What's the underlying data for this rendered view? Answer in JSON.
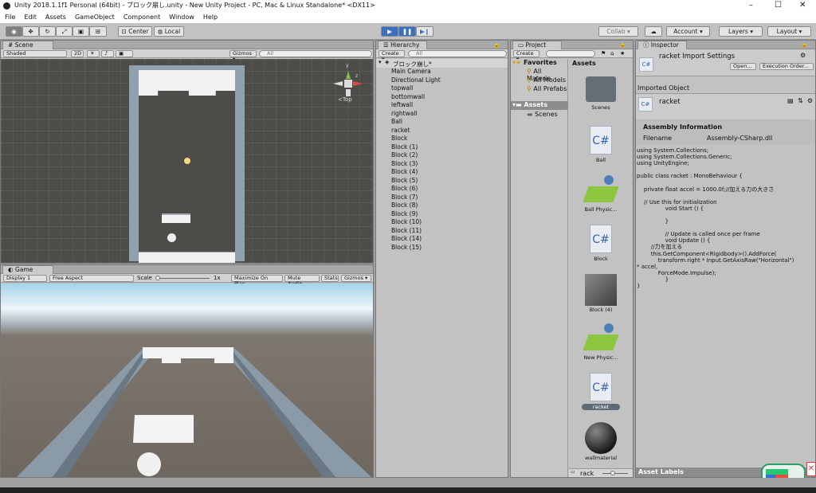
{
  "window": {
    "title": "Unity 2018.1.1f1 Personal (64bit) - ブロック崩し.unity - New Unity Project - PC, Mac & Linux Standalone* <DX11>",
    "minimize": "–",
    "maximize": "☐",
    "close": "✕"
  },
  "menu": [
    "File",
    "Edit",
    "Assets",
    "GameObject",
    "Component",
    "Window",
    "Help"
  ],
  "toolbar": {
    "center": "Center",
    "local": "Local",
    "collab": "Collab ▾",
    "account": "Account ▾",
    "layers": "Layers ▾",
    "layout": "Layout ▾"
  },
  "scene": {
    "tab": "Scene",
    "shading": "Shaded",
    "mode2d": "2D",
    "gizmos": "Gizmos ▾",
    "search_placeholder": "All",
    "gizmo_label": "Top",
    "axis_y": "y",
    "axis_z": "z"
  },
  "game": {
    "tab": "Game",
    "display": "Display 1",
    "aspect": "Free Aspect",
    "scale_label": "Scale",
    "scale_value": "1x",
    "maximize": "Maximize On Play",
    "mute": "Mute Audio",
    "stats": "Stats",
    "gizmos": "Gizmos ▾"
  },
  "hierarchy": {
    "tab": "Hierarchy",
    "create": "Create ▾",
    "search_placeholder": "All",
    "scene_name": "ブロック崩し*",
    "items": [
      "Main Camera",
      "Directional Light",
      "topwall",
      "bottomwall",
      "leftwall",
      "rightwall",
      "Ball",
      "racket",
      "Block",
      "Block (1)",
      "Block (2)",
      "Block (3)",
      "Block (4)",
      "Block (5)",
      "Block (6)",
      "Block (7)",
      "Block (8)",
      "Block (9)",
      "Block (10)",
      "Block (11)",
      "Block (14)",
      "Block (15)"
    ]
  },
  "project": {
    "tab": "Project",
    "create": "Create ▾",
    "favorites": "Favorites",
    "fav_items": [
      "All Materia",
      "All Models",
      "All Prefabs"
    ],
    "assets_root": "Assets",
    "folders": [
      "Scenes"
    ],
    "assets_header": "Assets",
    "search_value": "rack",
    "assets": [
      {
        "name": "Scenes",
        "icon": "folder"
      },
      {
        "name": "Ball",
        "icon": "cs"
      },
      {
        "name": "Ball Physic...",
        "icon": "physic"
      },
      {
        "name": "Block",
        "icon": "cs"
      },
      {
        "name": "Block (4)",
        "icon": "cube"
      },
      {
        "name": "New Physic...",
        "icon": "physic"
      },
      {
        "name": "racket",
        "icon": "cs"
      },
      {
        "name": "wallmaterial",
        "icon": "sphere"
      }
    ]
  },
  "inspector": {
    "tab": "Inspector",
    "title": "racket Import Settings",
    "open": "Open...",
    "exec_order": "Execution Order...",
    "imported_object": "Imported Object",
    "object_name": "racket",
    "assembly_header": "Assembly Information",
    "filename_label": "Filename",
    "filename_value": "Assembly-CSharp.dll",
    "asset_labels": "Asset Labels",
    "cs_badge": "C#",
    "code": "using System.Collections;\nusing System.Collections.Generic;\nusing UnityEngine;\n\npublic class racket : MonoBehaviour {\n\n    private float accel = 1000.0f;//加える力の大きさ\n\n    // Use this for initialization\n                void Start () {\n\n                }\n\n                // Update is called once per frame\n                void Update () {\n        //力を加える\n        this.GetComponent<Rigidbody>().AddForce(\n            transform.right * Input.GetAxisRaw(\"Horizontal\")\n* accel,\n            ForceMode.Impulse);\n                }\n}"
  }
}
